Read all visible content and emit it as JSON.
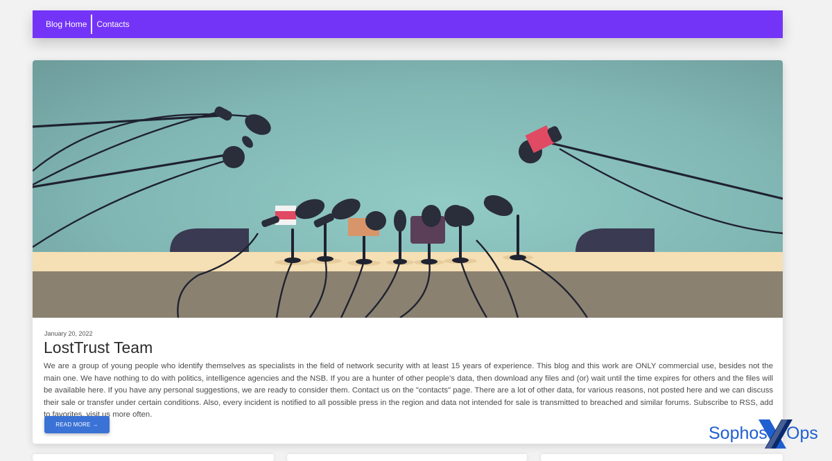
{
  "nav": {
    "items": [
      {
        "label": "Blog Home"
      },
      {
        "label": "Contacts"
      }
    ]
  },
  "post": {
    "date": "January 20, 2022",
    "title": "LostTrust Team",
    "body": "We are a group of young people who identify themselves as specialists in the field of network security with at least 15 years of experience. This blog and this work are ONLY commercial use, besides not the main one. We have nothing to do with politics, intelligence agencies and the NSB. If you are a hunter of other people's data, then download any files and (or) wait until the time expires for others and the files will be available here. If you have any personal suggestions, we are ready to consider them. Contact us on the \"contacts\" page. There are a lot of other data, for various reasons, not posted here and we can discuss their sale or transfer under certain conditions. Also, every incident is notified to all possible press in the region and data not intended for sale is transmitted to breached and similar forums. Subscribe to RSS, add to favorites, visit us more often.",
    "read_more": "READ MORE",
    "read_more_icon": "arrow-right-icon"
  },
  "watermark": {
    "text_left": "Sophos",
    "text_right": "Ops",
    "mark": "X"
  },
  "colors": {
    "nav_bg": "#7434f8",
    "button_bg": "#3a72d6",
    "watermark_blue": "#1f5fd0",
    "hero_sky": "#86c0bd",
    "hero_table": "#f5dfb4",
    "hero_floor": "#8a8170"
  }
}
